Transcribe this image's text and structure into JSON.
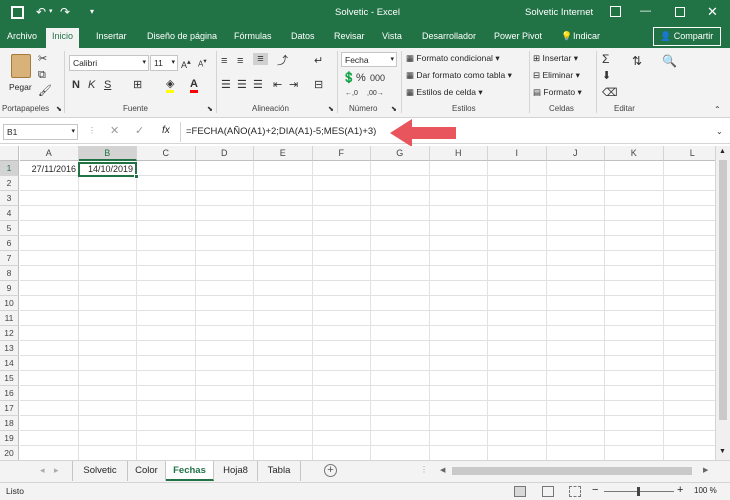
{
  "title_bar": {
    "app_title": "Solvetic - Excel",
    "account": "Solvetic Internet"
  },
  "ribbon_tabs": [
    "Archivo",
    "Inicio",
    "Insertar",
    "Diseño de página",
    "Fórmulas",
    "Datos",
    "Revisar",
    "Vista",
    "Desarrollador",
    "Power Pivot"
  ],
  "tell_me": "Indicar",
  "share_label": "Compartir",
  "clipboard": {
    "paste_label": "Pegar",
    "group_label": "Portapapeles"
  },
  "font": {
    "name": "Calibri",
    "size": "11",
    "group_label": "Fuente"
  },
  "alignment": {
    "group_label": "Alineación"
  },
  "number": {
    "format": "Fecha",
    "group_label": "Número"
  },
  "styles": {
    "conditional": "Formato condicional",
    "table": "Dar formato como tabla",
    "cell_styles": "Estilos de celda",
    "group_label": "Estilos"
  },
  "cells": {
    "insert": "Insertar",
    "delete": "Eliminar",
    "format": "Formato",
    "group_label": "Celdas"
  },
  "editing": {
    "group_label": "Editar"
  },
  "name_box": "B1",
  "fx_label": "fx",
  "formula": "=FECHA(AÑO(A1)+2;DIA(A1)-5;MES(A1)+3)",
  "columns": [
    "A",
    "B",
    "C",
    "D",
    "E",
    "F",
    "G",
    "H",
    "I",
    "J",
    "K",
    "L"
  ],
  "rows": [
    "1",
    "2",
    "3",
    "4",
    "5",
    "6",
    "7",
    "8",
    "9",
    "10",
    "11",
    "12",
    "13",
    "14",
    "15",
    "16",
    "17",
    "18",
    "19",
    "20"
  ],
  "cells_data": {
    "A1": "27/11/2016",
    "B1": "14/10/2019"
  },
  "sheets": [
    "Solvetic",
    "Color",
    "Fechas",
    "Hoja8",
    "Tabla"
  ],
  "active_sheet": "Fechas",
  "status": {
    "ready": "Listo",
    "zoom": "100 %"
  },
  "colors": {
    "excel_green": "#217346",
    "arrow": "#e8555c"
  }
}
